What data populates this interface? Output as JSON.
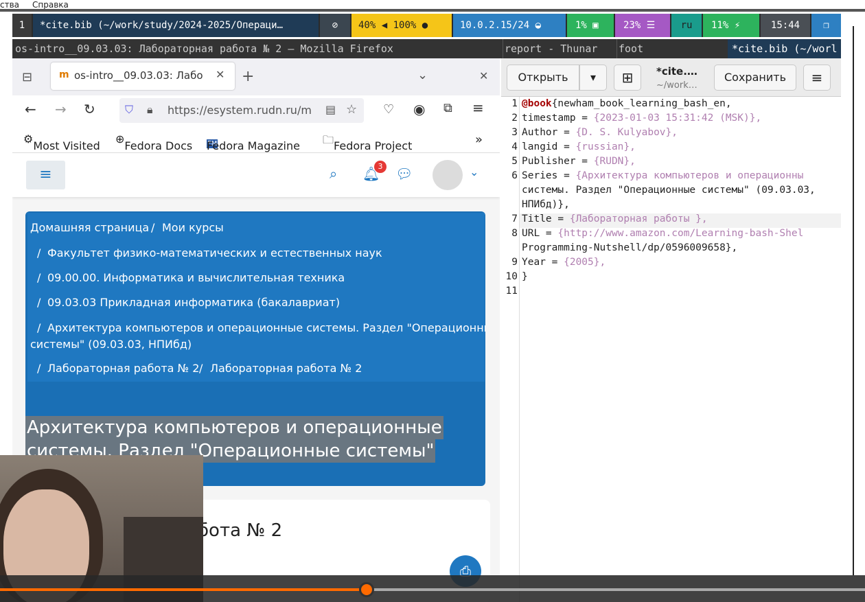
{
  "menu": {
    "item1": "ства",
    "item2": "Справка"
  },
  "swaybar": {
    "workspace": "1",
    "window_title": "*cite.bib (~/work/study/2024-2025/Операци…",
    "battery": "40%",
    "volume": "100%",
    "ip": "10.0.2.15/24",
    "cpu": "1%",
    "memory": "23%",
    "layout": "ru",
    "charge": "11%",
    "clock": "15:44",
    "colors": {
      "yellow": "#f5c518",
      "blue": "#2e80c2",
      "green": "#2db35d",
      "purple": "#a559c4",
      "teal": "#1a9c8c"
    }
  },
  "titles": {
    "firefox": "os-intro__09.03.03: Лабораторная работа № 2 — Mozilla Firefox",
    "thunar": "report - Thunar",
    "foot": "foot",
    "editor": "*cite.bib (~/worl"
  },
  "firefox": {
    "tab_title": "os-intro__09.03.03: Лабо",
    "url": "https://esystem.rudn.ru/m",
    "bookmarks": [
      "Most Visited",
      "Fedora Docs",
      "Fedora Magazine",
      "Fedora Project"
    ],
    "notif_count": "3",
    "breadcrumbs": {
      "home": "Домашняя страница",
      "courses": "Мои курсы",
      "faculty": "Факультет физико-математических и естественных наук",
      "informatics": "09.00.00. Информатика и вычислительная техника",
      "applied": "09.03.03 Прикладная информатика (бакалавриат)",
      "course_line1": "Архитектура компьютеров и операционные системы. Раздел \"Операционные",
      "course_line2": "системы\" (09.03.03, НПИбд)",
      "lab1": "Лабораторная работа № 2",
      "lab2": "Лабораторная работа № 2"
    },
    "course_title_line1": "Архитектура компьютеров и операционные",
    "course_title_line2": "системы. Раздел \"Операционные системы\"",
    "card_heading": "бота № 2"
  },
  "editor": {
    "open_label": "Открыть",
    "file_name": "*cite.…",
    "file_path": "~/work…",
    "save_label": "Сохранить",
    "lines": [
      {
        "n": "1",
        "text": "{newham_book_learning_bash_en,"
      },
      {
        "n": "2",
        "text": "  timestamp = {2023-01-03 15:31:42 (MSK)},"
      },
      {
        "n": "3",
        "text": "  Author = {D. S. Kulyabov},"
      },
      {
        "n": "4",
        "text": "  langid = {russian},"
      },
      {
        "n": "5",
        "text": "  Publisher = {RUDN},"
      },
      {
        "n": "6",
        "text": "  Series = {Архитектура компьютеров и операционны"
      },
      {
        "n": "",
        "text": "системы. Раздел \"Операционные системы\" (09.03.03,"
      },
      {
        "n": "",
        "text": "НПИбд)},"
      },
      {
        "n": "7",
        "text": "  Title = {Лабораторная работы },"
      },
      {
        "n": "8",
        "text": "  URL = {http://www.amazon.com/Learning-bash-Shel"
      },
      {
        "n": "",
        "text": "Programming-Nutshell/dp/0596009658},"
      },
      {
        "n": "9",
        "text": "  Year = {2005},"
      },
      {
        "n": "10",
        "text": "}"
      },
      {
        "n": "11",
        "text": ""
      }
    ],
    "keyword": "@book"
  },
  "video": {
    "progress": 0.424
  }
}
